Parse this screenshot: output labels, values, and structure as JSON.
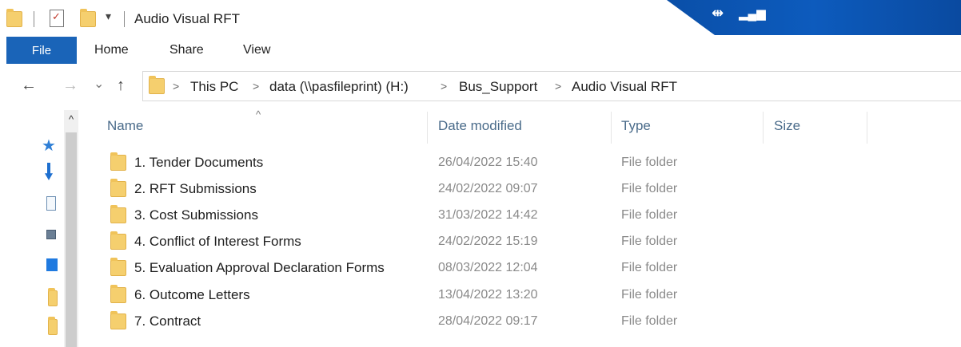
{
  "window": {
    "title": "Audio Visual RFT",
    "quick_access": {
      "dropdown_glyph": "▾"
    },
    "remote_bar": {
      "pin_glyph": "⇹",
      "signal_glyph": "▂▄▆"
    }
  },
  "ribbon": {
    "file_label": "File",
    "tabs": [
      {
        "label": "Home"
      },
      {
        "label": "Share"
      },
      {
        "label": "View"
      }
    ]
  },
  "navigation": {
    "back_glyph": "←",
    "forward_glyph": "→",
    "recent_glyph": "⌄",
    "up_glyph": "↑"
  },
  "breadcrumb": {
    "separator": ">",
    "items": [
      {
        "label": "This PC"
      },
      {
        "label": "data (\\\\pasfileprint) (H:)"
      },
      {
        "label": "Bus_Support"
      },
      {
        "label": "Audio Visual RFT"
      }
    ]
  },
  "nav_pane": {
    "scroll_up_glyph": "^",
    "items": [
      {
        "icon": "quick-access-star-icon"
      },
      {
        "icon": "downloads-arrow-icon"
      },
      {
        "icon": "document-icon"
      },
      {
        "icon": "pictures-icon"
      },
      {
        "icon": "desktop-blue-icon"
      },
      {
        "icon": "folder-icon"
      },
      {
        "icon": "folder-icon"
      }
    ]
  },
  "columns": {
    "sort_glyph": "^",
    "headers": [
      {
        "label": "Name"
      },
      {
        "label": "Date modified"
      },
      {
        "label": "Type"
      },
      {
        "label": "Size"
      }
    ]
  },
  "files": [
    {
      "name": "1. Tender Documents",
      "date": "26/04/2022 15:40",
      "type": "File folder"
    },
    {
      "name": "2. RFT Submissions",
      "date": "24/02/2022 09:07",
      "type": "File folder"
    },
    {
      "name": "3. Cost Submissions",
      "date": "31/03/2022 14:42",
      "type": "File folder"
    },
    {
      "name": "4. Conflict of Interest Forms",
      "date": "24/02/2022 15:19",
      "type": "File folder"
    },
    {
      "name": "5. Evaluation Approval Declaration Forms",
      "date": "08/03/2022 12:04",
      "type": "File folder"
    },
    {
      "name": "6. Outcome Letters",
      "date": "13/04/2022 13:20",
      "type": "File folder"
    },
    {
      "name": "7. Contract",
      "date": "28/04/2022 09:17",
      "type": "File folder"
    }
  ],
  "colors": {
    "ribbon_file_tab": "#1a64b8",
    "remote_bar": "#0d5bbd",
    "folder": "#f5cf6e",
    "header_text": "#4a6b8a",
    "meta_text": "#8a8a8a"
  }
}
